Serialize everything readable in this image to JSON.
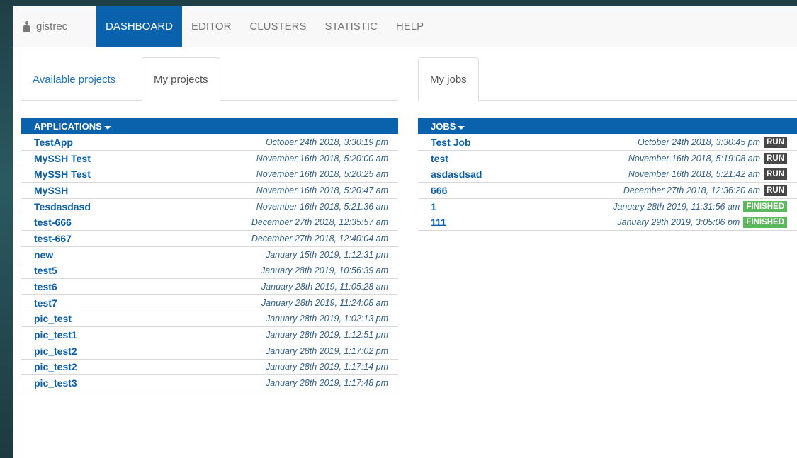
{
  "navbar": {
    "user": "gistrec",
    "items": [
      {
        "label": "DASHBOARD",
        "active": true
      },
      {
        "label": "EDITOR",
        "active": false
      },
      {
        "label": "CLUSTERS",
        "active": false
      },
      {
        "label": "STATISTIC",
        "active": false
      },
      {
        "label": "HELP",
        "active": false
      }
    ]
  },
  "left": {
    "tabs": [
      {
        "label": "Available projects",
        "active": false
      },
      {
        "label": "My projects",
        "active": true
      }
    ],
    "header": "APPLICATIONS",
    "rows": [
      {
        "name": "TestApp",
        "date": "October 24th 2018, 3:30:19 pm"
      },
      {
        "name": "MySSH Test",
        "date": "November 16th 2018, 5:20:00 am"
      },
      {
        "name": "MySSH Test",
        "date": "November 16th 2018, 5:20:25 am"
      },
      {
        "name": "MySSH",
        "date": "November 16th 2018, 5:20:47 am"
      },
      {
        "name": "Tesdasdasd",
        "date": "November 16th 2018, 5:21:36 am"
      },
      {
        "name": "test-666",
        "date": "December 27th 2018, 12:35:57 am"
      },
      {
        "name": "test-667",
        "date": "December 27th 2018, 12:40:04 am"
      },
      {
        "name": "new",
        "date": "January 15th 2019, 1:12:31 pm"
      },
      {
        "name": "test5",
        "date": "January 28th 2019, 10:56:39 am"
      },
      {
        "name": "test6",
        "date": "January 28th 2019, 11:05:28 am"
      },
      {
        "name": "test7",
        "date": "January 28th 2019, 11:24:08 am"
      },
      {
        "name": "pic_test",
        "date": "January 28th 2019, 1:02:13 pm"
      },
      {
        "name": "pic_test1",
        "date": "January 28th 2019, 1:12:51 pm"
      },
      {
        "name": "pic_test2",
        "date": "January 28th 2019, 1:17:02 pm"
      },
      {
        "name": "pic_test2",
        "date": "January 28th 2019, 1:17:14 pm"
      },
      {
        "name": "pic_test3",
        "date": "January 28th 2019, 1:17:48 pm"
      }
    ]
  },
  "right": {
    "tabs": [
      {
        "label": "My jobs",
        "active": true
      }
    ],
    "header": "JOBS",
    "rows": [
      {
        "name": "Test Job",
        "date": "October 24th 2018, 3:30:45 pm",
        "status": "RUN"
      },
      {
        "name": "test",
        "date": "November 16th 2018, 5:19:08 am",
        "status": "RUN"
      },
      {
        "name": "asdasdsad",
        "date": "November 16th 2018, 5:21:42 am",
        "status": "RUN"
      },
      {
        "name": "666",
        "date": "December 27th 2018, 12:36:20 am",
        "status": "RUN"
      },
      {
        "name": "1",
        "date": "January 28th 2019, 11:31:56 am",
        "status": "FINISHED"
      },
      {
        "name": "111",
        "date": "January 29th 2019, 3:05:06 pm",
        "status": "FINISHED"
      }
    ]
  },
  "colors": {
    "primary": "#0b62ac",
    "run_badge": "#474747",
    "finished_badge": "#5cb85c"
  }
}
